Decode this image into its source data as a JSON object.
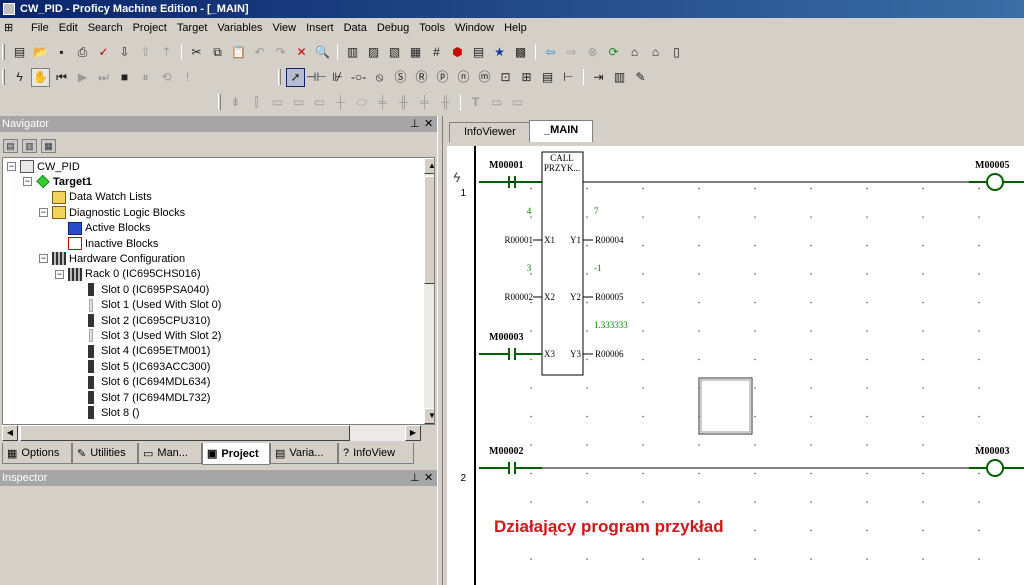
{
  "window": {
    "title": "CW_PID - Proficy Machine Edition - [_MAIN]"
  },
  "menu": [
    "File",
    "Edit",
    "Search",
    "Project",
    "Target",
    "Variables",
    "View",
    "Insert",
    "Data",
    "Debug",
    "Tools",
    "Window",
    "Help"
  ],
  "navigator": {
    "title": "Navigator",
    "tree": [
      {
        "label": "CW_PID",
        "level": 0,
        "bold": false,
        "exp": "-",
        "icon": "project-icon"
      },
      {
        "label": "Target1",
        "level": 1,
        "bold": true,
        "exp": "-",
        "icon": "target-icon"
      },
      {
        "label": "Data Watch Lists",
        "level": 2,
        "bold": false,
        "exp": "",
        "icon": "watch-list-icon"
      },
      {
        "label": "Diagnostic Logic Blocks",
        "level": 2,
        "bold": false,
        "exp": "-",
        "icon": "folder-icon"
      },
      {
        "label": "Active Blocks",
        "level": 3,
        "bold": false,
        "exp": "",
        "icon": "active-block-icon"
      },
      {
        "label": "Inactive Blocks",
        "level": 3,
        "bold": false,
        "exp": "",
        "icon": "inactive-block-icon"
      },
      {
        "label": "Hardware Configuration",
        "level": 2,
        "bold": false,
        "exp": "-",
        "icon": "hardware-icon"
      },
      {
        "label": "Rack 0 (IC695CHS016)",
        "level": 3,
        "bold": false,
        "exp": "-",
        "icon": "rack-icon"
      },
      {
        "label": "Slot 0 (IC695PSA040)",
        "level": 4,
        "bold": false,
        "exp": "",
        "icon": "module-icon"
      },
      {
        "label": "Slot 1 (Used With Slot 0)",
        "level": 4,
        "bold": false,
        "exp": "",
        "icon": "slot-empty-icon"
      },
      {
        "label": "Slot 2 (IC695CPU310)",
        "level": 4,
        "bold": false,
        "exp": "",
        "icon": "module-icon"
      },
      {
        "label": "Slot 3 (Used With Slot 2)",
        "level": 4,
        "bold": false,
        "exp": "",
        "icon": "slot-empty-icon"
      },
      {
        "label": "Slot 4 (IC695ETM001)",
        "level": 4,
        "bold": false,
        "exp": "",
        "icon": "module-icon"
      },
      {
        "label": "Slot 5 (IC693ACC300)",
        "level": 4,
        "bold": false,
        "exp": "",
        "icon": "module-icon"
      },
      {
        "label": "Slot 6 (IC694MDL634)",
        "level": 4,
        "bold": false,
        "exp": "",
        "icon": "module-icon"
      },
      {
        "label": "Slot 7 (IC694MDL732)",
        "level": 4,
        "bold": false,
        "exp": "",
        "icon": "module-icon"
      },
      {
        "label": "Slot 8 ()",
        "level": 4,
        "bold": false,
        "exp": "",
        "icon": "module-icon"
      }
    ],
    "tabs": [
      {
        "label": "Options",
        "icon": "options-tab-icon",
        "glyph": "▦",
        "active": false
      },
      {
        "label": "Utilities",
        "icon": "utilities-tab-icon",
        "glyph": "✎",
        "active": false
      },
      {
        "label": "Man...",
        "icon": "manuals-tab-icon",
        "glyph": "▭",
        "active": false
      },
      {
        "label": "Project",
        "icon": "project-tab-icon",
        "glyph": "▣",
        "active": true
      },
      {
        "label": "Varia...",
        "icon": "variables-tab-icon",
        "glyph": "▤",
        "active": false
      },
      {
        "label": "InfoView",
        "icon": "infoview-tab-icon",
        "glyph": "?",
        "active": false
      }
    ]
  },
  "inspector": {
    "title": "Inspector"
  },
  "editor": {
    "tabs": [
      {
        "label": "InfoViewer",
        "active": false
      },
      {
        "label": "_MAIN",
        "active": true
      }
    ]
  },
  "ladder": {
    "rung1": {
      "number": "1",
      "input_contact": "M00001",
      "output_coil": "M00005",
      "call_block": {
        "title": "CALL",
        "name": "PRZYK..."
      },
      "pins": [
        {
          "in_value": "4",
          "out_value": "7",
          "in_name": "X1",
          "out_name": "Y1",
          "in_var": "R00001",
          "out_var": "R00004"
        },
        {
          "in_value": "3",
          "out_value": "-1",
          "in_name": "X2",
          "out_name": "Y2",
          "in_var": "R00002",
          "out_var": "R00005"
        },
        {
          "in_value": "",
          "out_value": "1.333333",
          "in_name": "X3",
          "out_name": "Y3",
          "in_var": "M00003",
          "out_var": "R00006"
        }
      ]
    },
    "rung2": {
      "number": "2",
      "input_contact": "M00002",
      "output_coil": "M00003"
    },
    "annotation": "Działający program przykład",
    "accent_color": "#d01818",
    "value_color": "#008000"
  }
}
